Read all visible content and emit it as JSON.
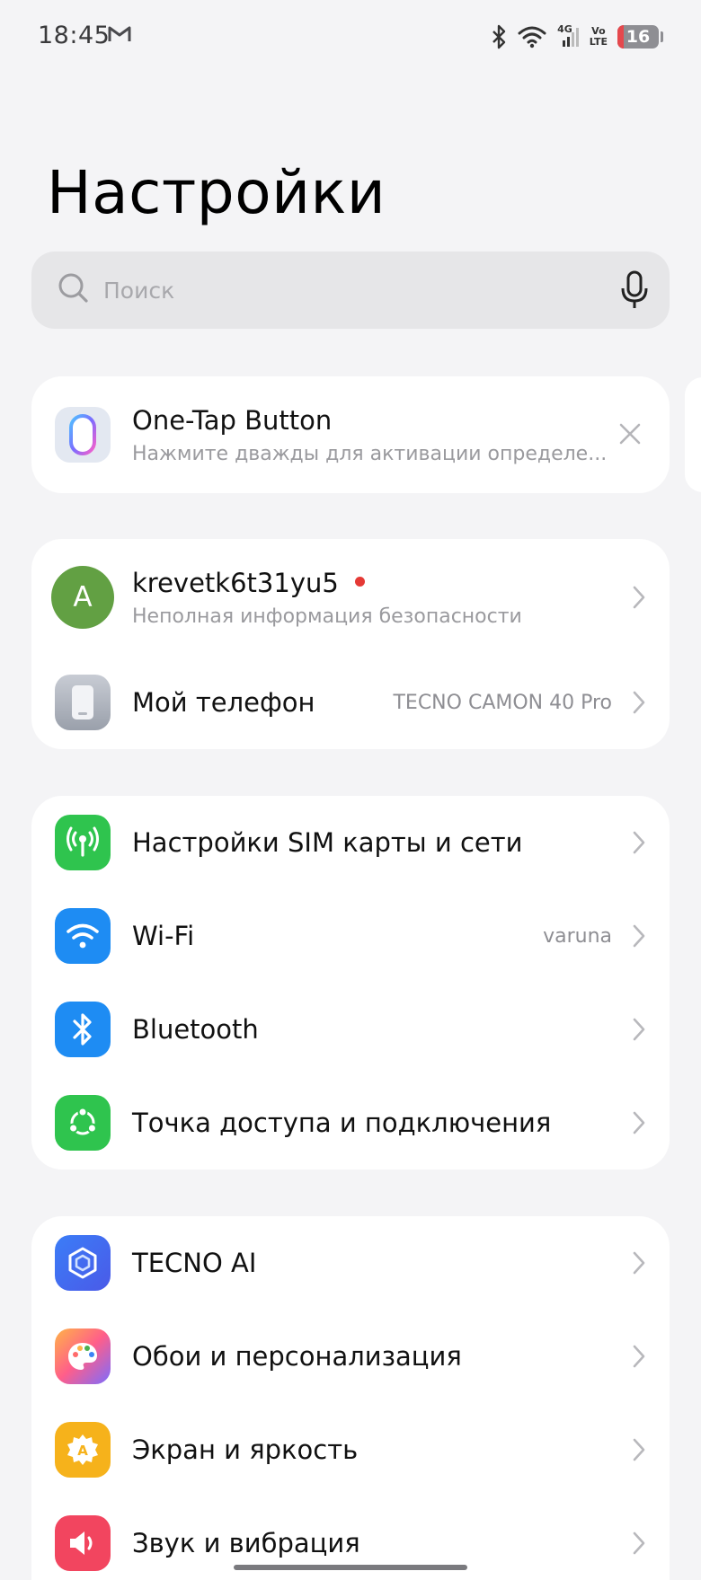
{
  "status_bar": {
    "time": "18:45",
    "notification_icon": "gmail-icon",
    "network_type": "4G",
    "volte_top": "Vo",
    "volte_bottom": "LTE",
    "battery_level": "16"
  },
  "page_title": "Настройки",
  "search": {
    "placeholder": "Поиск"
  },
  "one_tap": {
    "title": "One-Tap Button",
    "subtitle": "Нажмите дважды для активации определе..."
  },
  "account": {
    "avatar_letter": "A",
    "name": "krevetk6t31yu5",
    "subtitle": "Неполная информация безопасности"
  },
  "my_phone": {
    "label": "Мой телефон",
    "value": "TECNO CAMON 40 Pro"
  },
  "network_group": [
    {
      "label": "Настройки SIM карты и сети",
      "value": ""
    },
    {
      "label": "Wi-Fi",
      "value": "varuna"
    },
    {
      "label": "Bluetooth",
      "value": ""
    },
    {
      "label": "Точка доступа и подключения",
      "value": ""
    }
  ],
  "personal_group": [
    {
      "label": "TECNO AI"
    },
    {
      "label": "Обои и персонализация"
    },
    {
      "label": "Экран и яркость"
    },
    {
      "label": "Звук и вибрация"
    }
  ],
  "colors": {
    "background": "#f4f4f6",
    "green": "#2fc44e",
    "blue": "#1e8cf3",
    "avatar": "#62a043",
    "badge": "#e53935"
  }
}
